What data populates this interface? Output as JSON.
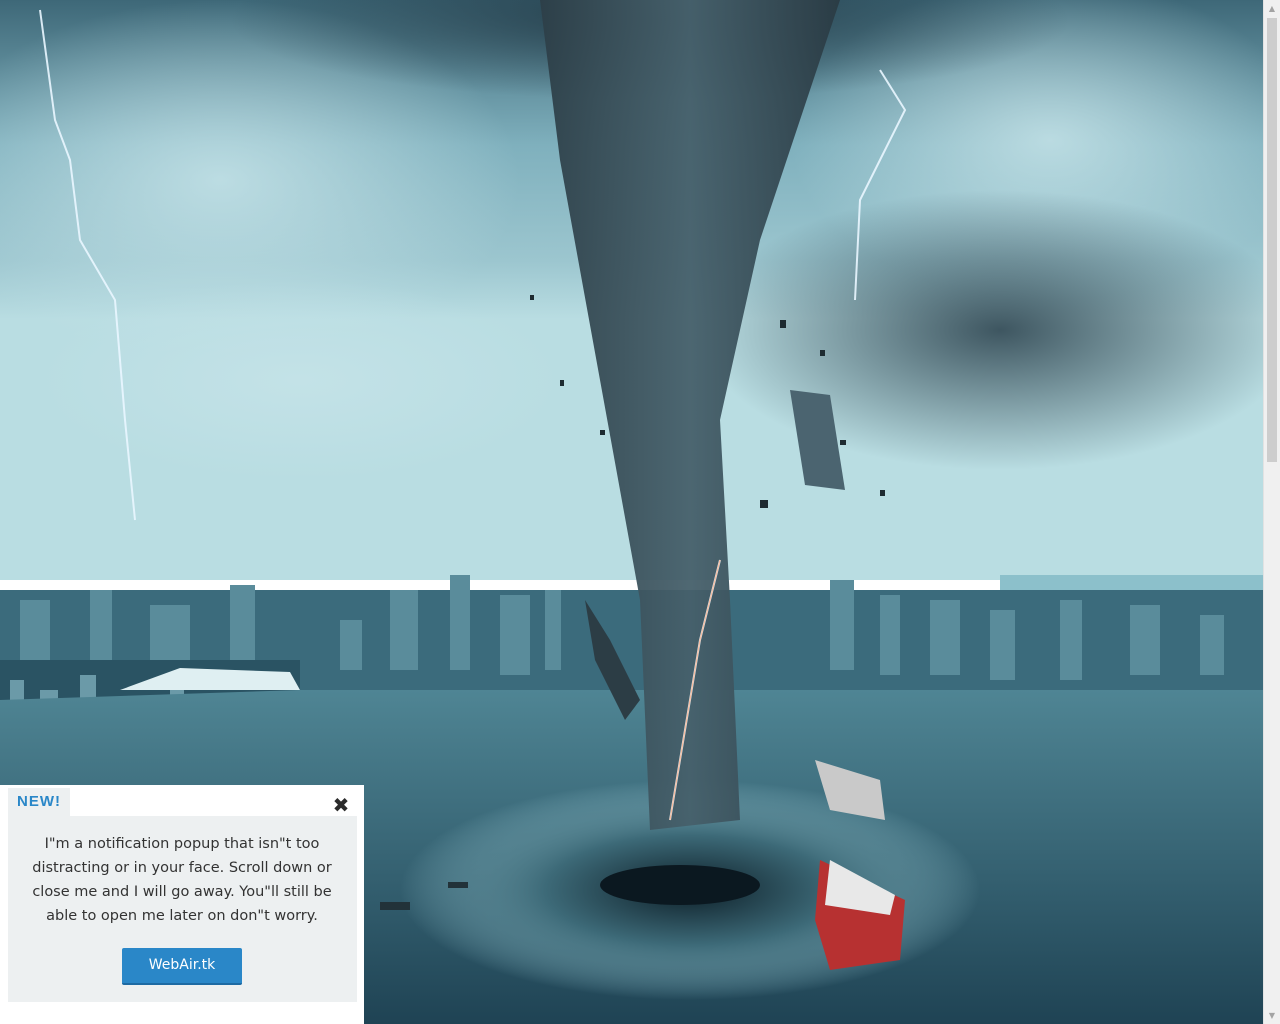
{
  "background": {
    "image": "tornado-over-city-harbor",
    "sky_color": "#5f93a2",
    "water_color": "#2f5d6e"
  },
  "popup": {
    "badge": "NEW!",
    "close_icon": "close-icon",
    "message": "I\"m a notification popup that isn\"t too distracting or in your face. Scroll down or close me and I will go away. You\"ll still be able to open me later on don\"t worry.",
    "button_label": "WebAir.tk",
    "accent_color": "#2a87c8"
  },
  "scrollbar": {
    "up_icon": "scroll-up-arrow-icon",
    "down_icon": "scroll-down-arrow-icon"
  }
}
